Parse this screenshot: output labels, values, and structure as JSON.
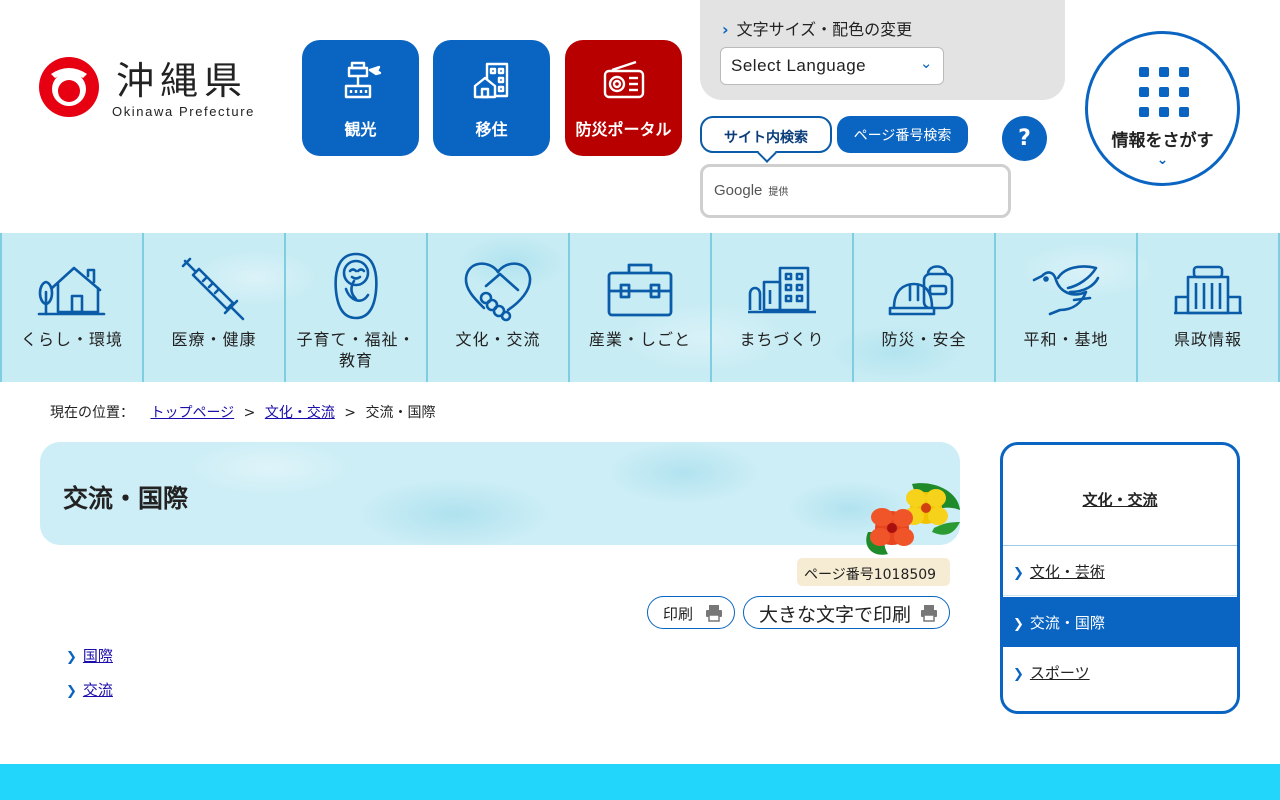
{
  "header": {
    "logo_title": "沖縄県",
    "logo_subtitle": "Okinawa Prefecture",
    "quick_links": [
      {
        "label": "観光",
        "icon": "tower-icon",
        "color": "#0a64c2"
      },
      {
        "label": "移住",
        "icon": "house-icon",
        "color": "#0a64c2"
      },
      {
        "label": "防災ポータル",
        "icon": "radio-icon",
        "color": "#b80000"
      }
    ],
    "settings_link": "文字サイズ・配色の変更",
    "language_select": "Select Language",
    "search_tabs": {
      "site": "サイト内検索",
      "page": "ページ番号検索"
    },
    "help_label": "?",
    "search_brand": "Google",
    "search_brand_suffix": "提供",
    "info_button": "情報をさがす"
  },
  "categories": [
    {
      "label": "くらし・環境",
      "icon": "house-tree-icon"
    },
    {
      "label": "医療・健康",
      "icon": "syringe-icon"
    },
    {
      "label": "子育て・福祉・教育",
      "icon": "baby-icon"
    },
    {
      "label": "文化・交流",
      "icon": "handshake-heart-icon"
    },
    {
      "label": "産業・しごと",
      "icon": "briefcase-icon"
    },
    {
      "label": "まちづくり",
      "icon": "buildings-icon"
    },
    {
      "label": "防災・安全",
      "icon": "helmet-bag-icon"
    },
    {
      "label": "平和・基地",
      "icon": "dove-icon"
    },
    {
      "label": "県政情報",
      "icon": "government-building-icon"
    }
  ],
  "breadcrumb": {
    "label": "現在の位置：",
    "items": [
      "トップページ",
      "文化・交流"
    ],
    "current": "交流・国際",
    "separator": ">"
  },
  "page": {
    "title": "交流・国際",
    "page_number": "ページ番号1018509",
    "print": "印刷",
    "print_large": "大きな文字で印刷",
    "links": [
      "国際",
      "交流"
    ]
  },
  "sidemenu": {
    "heading": "文化・交流",
    "items": [
      "文化・芸術",
      "交流・国際",
      "スポーツ"
    ],
    "active_index": 1
  },
  "colors": {
    "primary": "#0a64c2",
    "disaster": "#b80000",
    "nav_bg": "#c8ecf4",
    "footer": "#22d5fb"
  }
}
